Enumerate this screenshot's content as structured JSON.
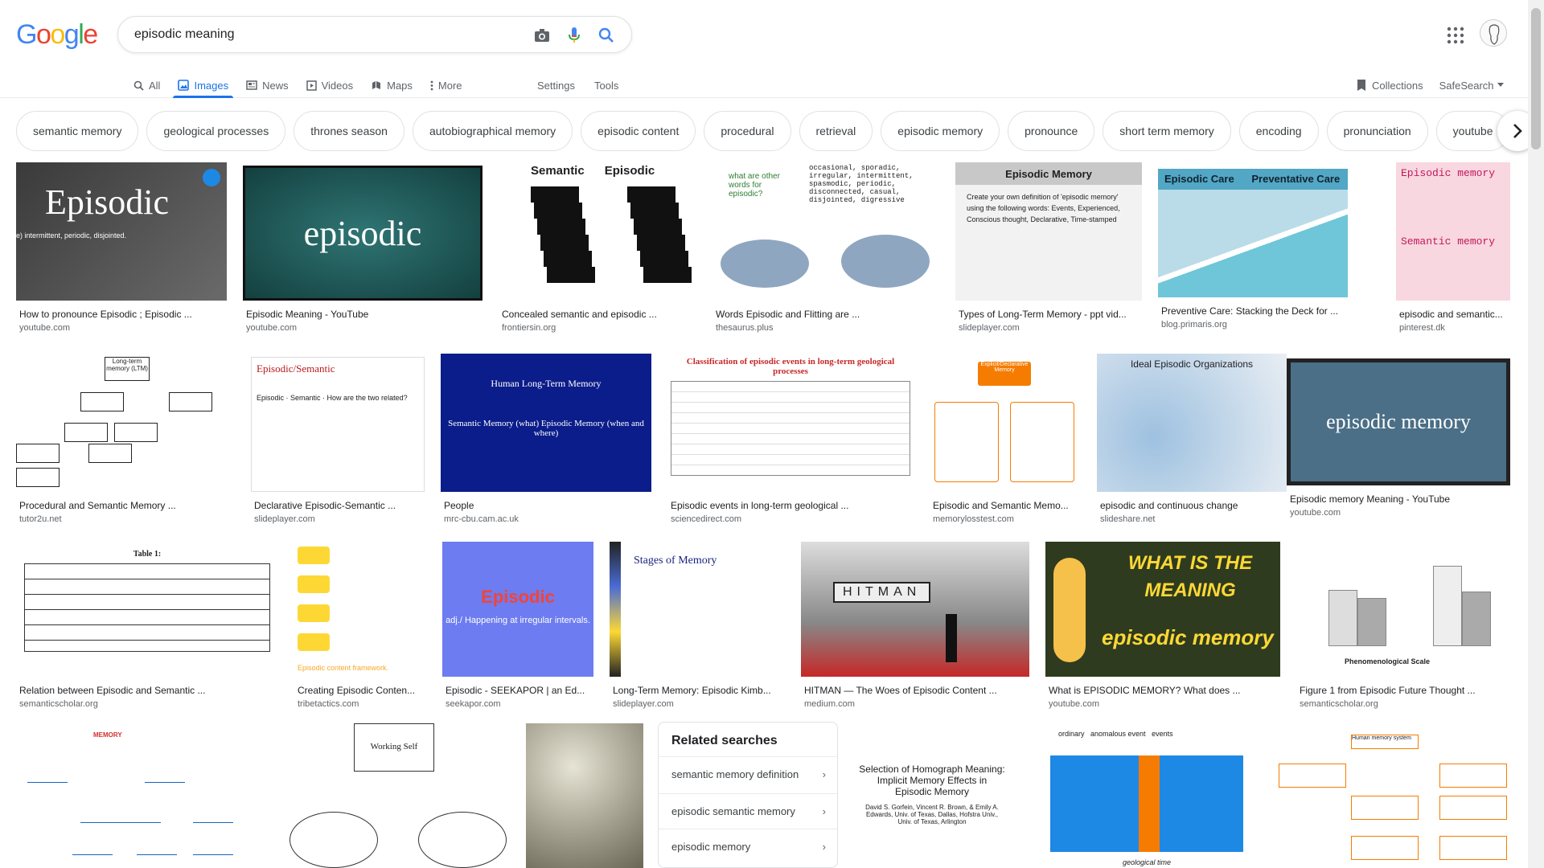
{
  "logo": {
    "letters": [
      "G",
      "o",
      "o",
      "g",
      "l",
      "e"
    ],
    "colors": [
      "#4285f4",
      "#ea4335",
      "#fbbc05",
      "#4285f4",
      "#34a853",
      "#ea4335"
    ]
  },
  "search": {
    "query": "episodic meaning"
  },
  "tabs": [
    {
      "label": "All",
      "icon": "search-icon"
    },
    {
      "label": "Images",
      "icon": "image-icon",
      "active": true
    },
    {
      "label": "News",
      "icon": "news-icon"
    },
    {
      "label": "Videos",
      "icon": "video-icon"
    },
    {
      "label": "Maps",
      "icon": "map-icon"
    },
    {
      "label": "More",
      "icon": "more-vert-icon"
    }
  ],
  "tools": {
    "settings": "Settings",
    "tools": "Tools",
    "collections": "Collections",
    "safesearch": "SafeSearch"
  },
  "chips": [
    "semantic memory",
    "geological processes",
    "thrones season",
    "autobiographical memory",
    "episodic content",
    "procedural",
    "retrieval",
    "episodic memory",
    "pronounce",
    "short term memory",
    "encoding",
    "pronunciation",
    "youtube"
  ],
  "results": [
    {
      "title": "How to pronounce Episodic ; Episodic ...",
      "source": "youtube.com",
      "thumb_text": "Episodic",
      "thumb_sub": "e) intermittent, periodic, disjointed.",
      "theme": "dark-grey"
    },
    {
      "title": "Episodic Meaning - YouTube",
      "source": "youtube.com",
      "thumb_text": "episodic",
      "theme": "teal"
    },
    {
      "title": "Concealed semantic and episodic ...",
      "source": "frontiersin.org",
      "thumb_text": "Semantic      Episodic",
      "theme": "cards"
    },
    {
      "title": "Words Episodic and Flitting are ...",
      "source": "thesaurus.plus",
      "thumb_text": "what are other words for episodic?",
      "thumb_sub": "occasional, sporadic, irregular, intermittent, spasmodic, periodic, disconnected, casual, disjointed, digressive",
      "theme": "pigeons"
    },
    {
      "title": "Types of Long-Term Memory - ppt vid...",
      "source": "slideplayer.com",
      "thumb_text": "Episodic Memory",
      "thumb_sub": "Create your own definition of 'episodic memory' using the following words: Events, Experienced, Conscious thought, Declarative, Time-stamped",
      "theme": "slide-grey"
    },
    {
      "title": "Preventive Care: Stacking the Deck for ...",
      "source": "blog.primaris.org",
      "thumb_text": "Episodic Care      Preventative Care",
      "theme": "blue-slide"
    },
    {
      "title": "episodic and semantic...",
      "source": "pinterest.dk",
      "thumb_text": "Episodic memory",
      "thumb_sub": "Semantic memory",
      "theme": "pink"
    },
    {
      "title": "Procedural and Semantic Memory ...",
      "source": "tutor2u.net",
      "thumb_text": "Long-term memory (LTM)",
      "theme": "tree"
    },
    {
      "title": "Declarative Episodic-Semantic ...",
      "source": "slideplayer.com",
      "thumb_text": "Episodic/Semantic",
      "thumb_sub": "Episodic · Semantic · How are the two related?",
      "theme": "white-slide"
    },
    {
      "title": "People",
      "source": "mrc-cbu.cam.ac.uk",
      "thumb_text": "Human Long-Term Memory",
      "thumb_sub": "Semantic Memory (what)   Episodic Memory (when and where)",
      "theme": "navy"
    },
    {
      "title": "Episodic events in long-term geological ...",
      "source": "sciencedirect.com",
      "thumb_text": "Classification of episodic events in long-term geological processes",
      "theme": "table-red"
    },
    {
      "title": "Episodic and Semantic Memo...",
      "source": "memorylosstest.com",
      "thumb_text": "Explicit/Declarative Memory",
      "theme": "orange-tree"
    },
    {
      "title": "episodic and continuous change",
      "source": "slideshare.net",
      "thumb_text": "Ideal Episodic Organizations",
      "theme": "bubbles"
    },
    {
      "title": "Episodic memory Meaning - YouTube",
      "source": "youtube.com",
      "thumb_text": "episodic memory",
      "theme": "slate"
    },
    {
      "title": "Relation between Episodic and Semantic ...",
      "source": "semanticscholar.org",
      "thumb_text": "Table 1:",
      "theme": "table"
    },
    {
      "title": "Creating Episodic Conten...",
      "source": "tribetactics.com",
      "thumb_text": "Episodic content framework.",
      "theme": "yellow"
    },
    {
      "title": "Episodic - SEEKAPOR | an Ed...",
      "source": "seekapor.com",
      "thumb_text": "Episodic",
      "thumb_sub": "adj./ Happening at irregular intervals.",
      "theme": "periwinkle"
    },
    {
      "title": "Long-Term Memory: Episodic Kimb...",
      "source": "slideplayer.com",
      "thumb_text": "Stages of Memory",
      "theme": "film"
    },
    {
      "title": "HITMAN — The Woes of Episodic Content ...",
      "source": "medium.com",
      "thumb_text": "HITMAN",
      "theme": "hitman"
    },
    {
      "title": "What is EPISODIC MEMORY? What does ...",
      "source": "youtube.com",
      "thumb_text": "WHAT IS THE MEANING",
      "thumb_sub": "episodic memory",
      "theme": "green-cartoon"
    },
    {
      "title": "Figure 1 from Episodic Future Thought ...",
      "source": "semanticscholar.org",
      "thumb_text": "Phenomenological Scale",
      "theme": "barchart"
    },
    {
      "title": "",
      "source": "",
      "thumb_text": "MEMORY",
      "theme": "red-tree"
    },
    {
      "title": "",
      "source": "",
      "thumb_text": "Working Self",
      "theme": "ovals"
    },
    {
      "title": "",
      "source": "",
      "thumb_text": "",
      "theme": "photo"
    },
    {
      "title": "",
      "source": "",
      "thumb_text": "Selection of Homograph Meaning: Implicit Memory Effects in Episodic Memory",
      "thumb_sub": "David S. Gorfein, Vincent R. Brown, & Emily A. Edwards, Univ. of Texas, Dallas, Hofstra Univ., Univ. of Texas, Arlington",
      "theme": "paper"
    },
    {
      "title": "",
      "source": "",
      "thumb_text": "ordinary   anomalous event   events",
      "thumb_sub": "geological time",
      "theme": "bluechart"
    },
    {
      "title": "",
      "source": "",
      "thumb_text": "Human memory system",
      "theme": "orange-boxes"
    }
  ],
  "related": {
    "heading": "Related searches",
    "items": [
      "semantic memory definition",
      "episodic semantic memory",
      "episodic memory"
    ]
  }
}
